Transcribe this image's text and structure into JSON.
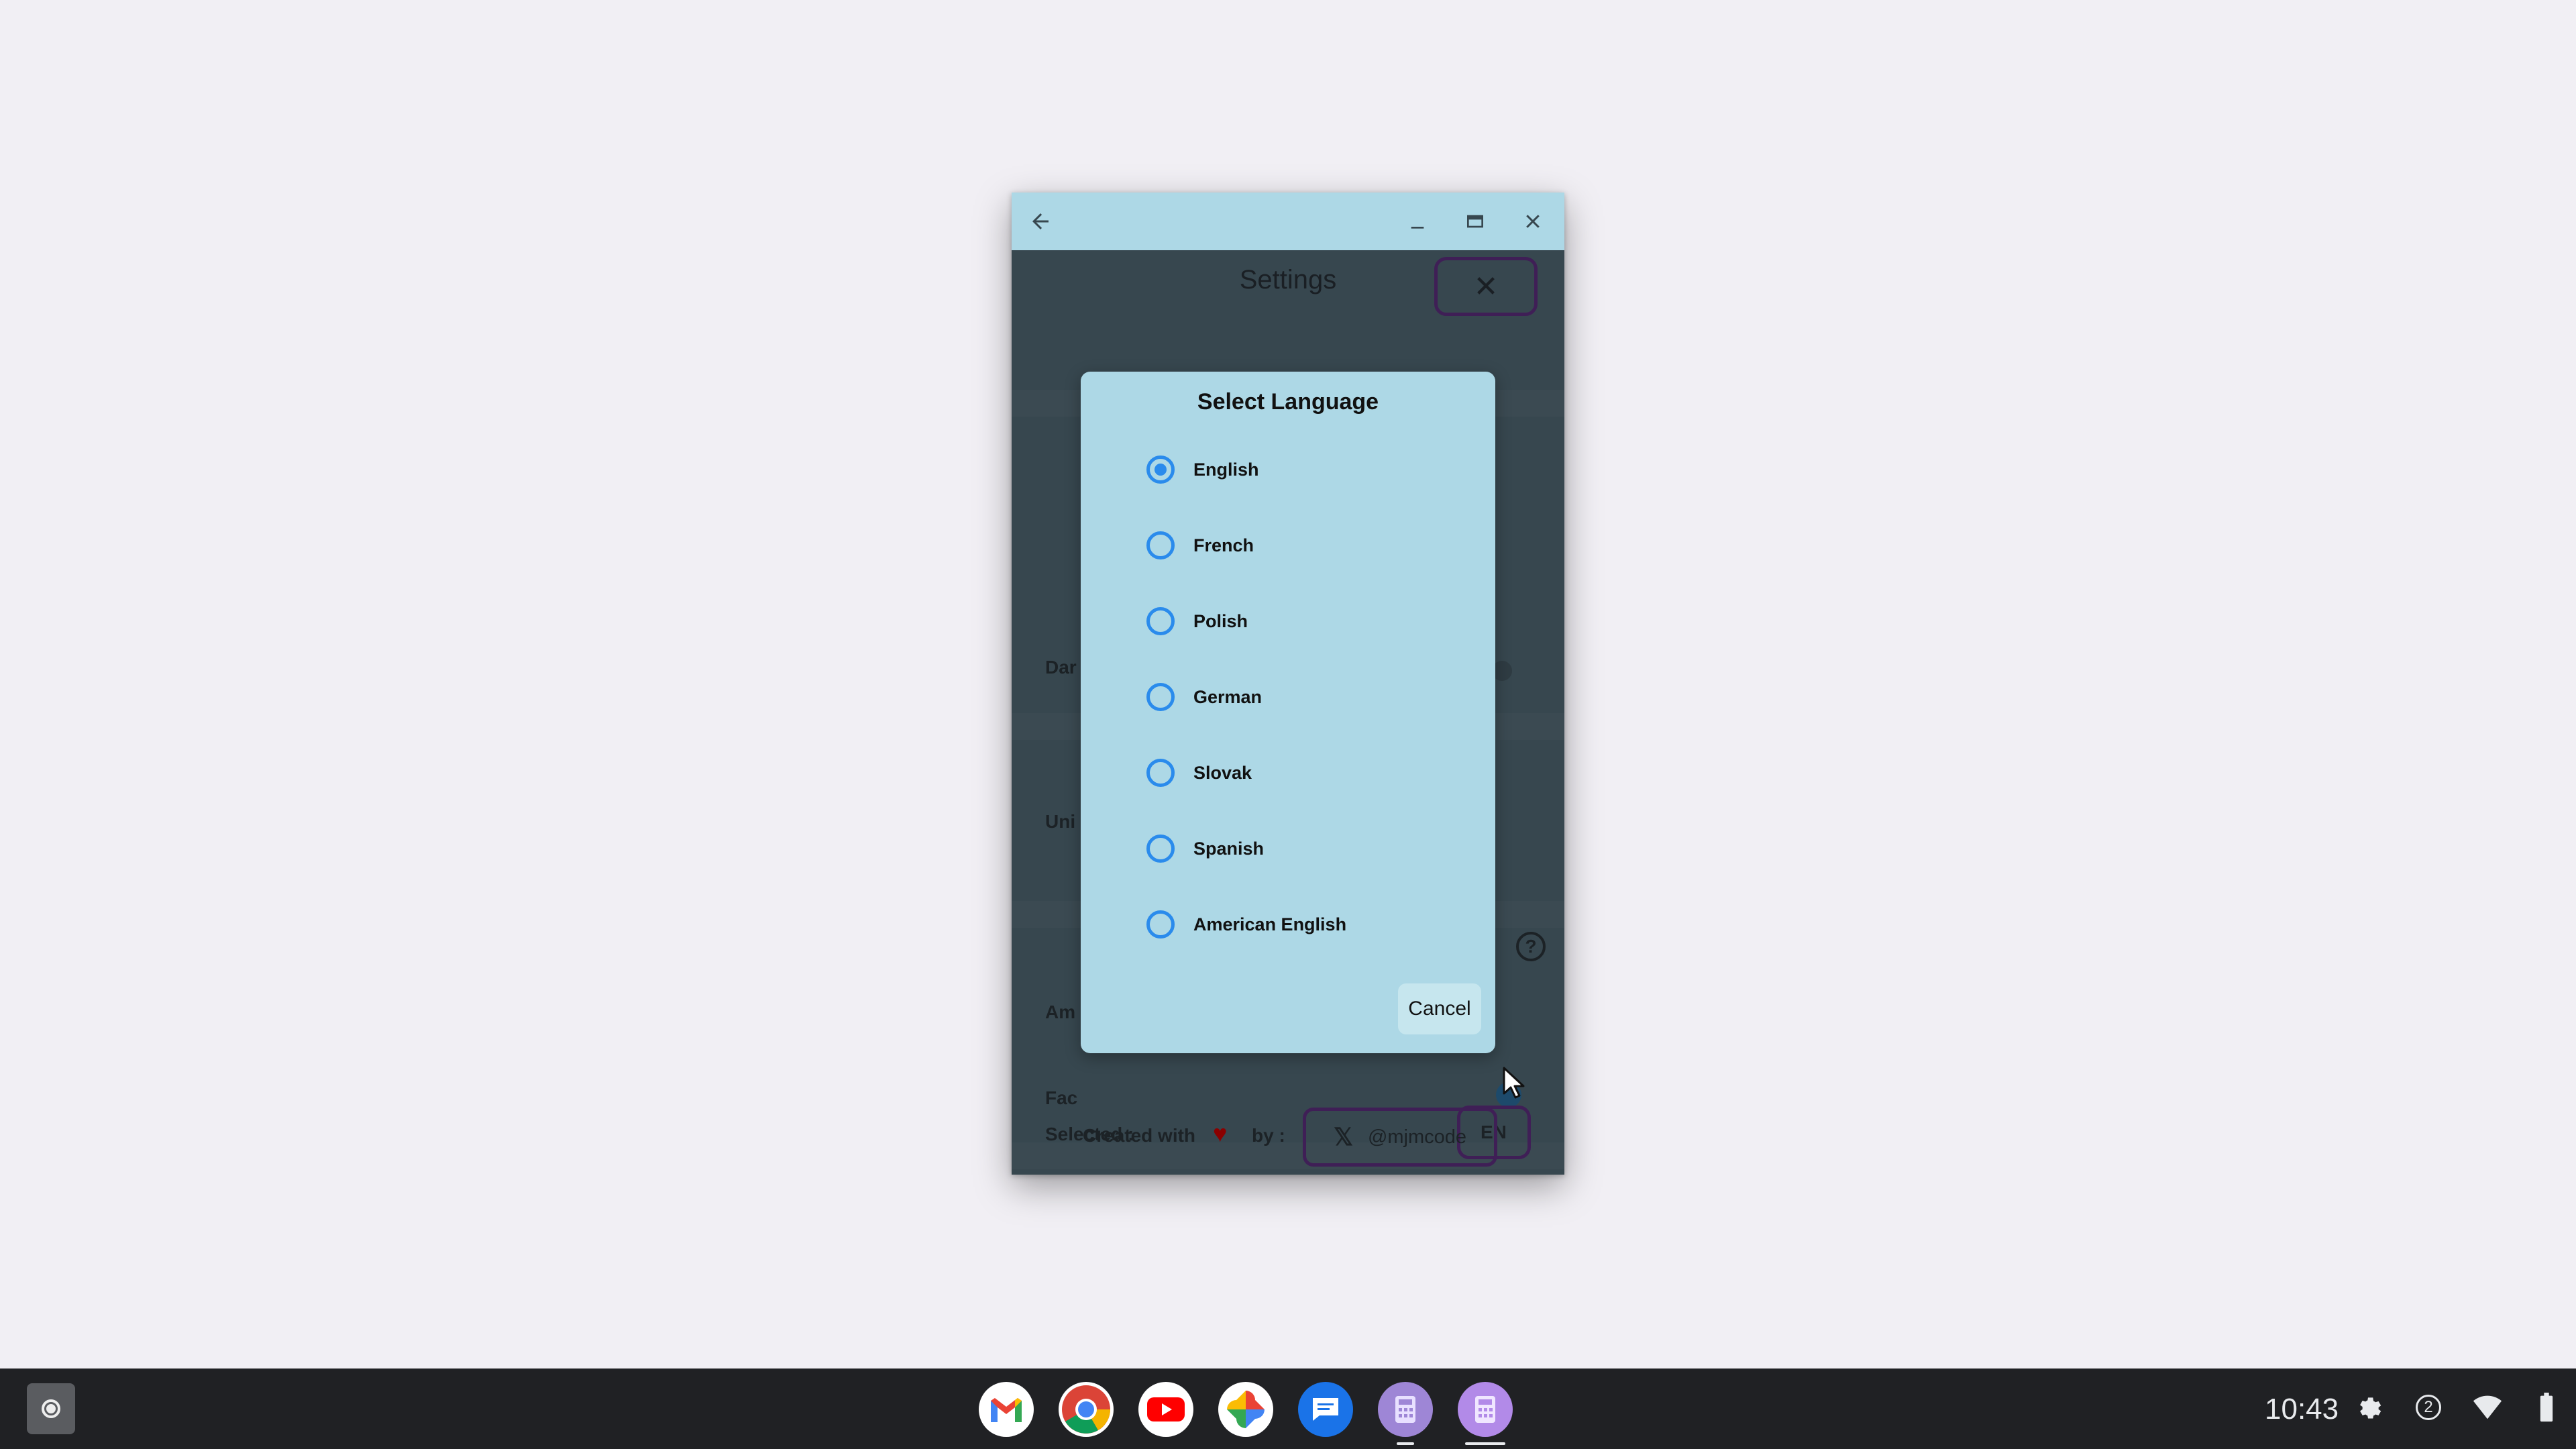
{
  "window": {
    "back_icon": "arrow-left-icon",
    "minimize_icon": "minimize-icon",
    "maximize_icon": "maximize-icon",
    "close_icon": "close-icon"
  },
  "settings": {
    "title": "Settings",
    "close_glyph": "✕",
    "rows": {
      "dark_label": "Dar",
      "units_label": "Uni",
      "amp_label": "Am",
      "fact_label": "Fac"
    },
    "help_glyph": "?",
    "selected_label": "Selected :",
    "selected_value": "EN",
    "footer": {
      "created_with": "Created with",
      "by": "by :",
      "x_logo": "𝕏",
      "handle": "@mjmcode"
    }
  },
  "dialog": {
    "title": "Select Language",
    "options": [
      {
        "label": "English",
        "checked": true
      },
      {
        "label": "French",
        "checked": false
      },
      {
        "label": "Polish",
        "checked": false
      },
      {
        "label": "German",
        "checked": false
      },
      {
        "label": "Slovak",
        "checked": false
      },
      {
        "label": "Spanish",
        "checked": false
      },
      {
        "label": "American English",
        "checked": false
      }
    ],
    "cancel_label": "Cancel"
  },
  "shelf": {
    "apps": [
      "Gmail",
      "Chrome",
      "YouTube",
      "Photos",
      "Messages",
      "Calculator",
      "Calculator"
    ],
    "time": "10:43",
    "notification_count": "2",
    "tray_icons": [
      "settings-icon",
      "notification-icon",
      "wifi-icon",
      "battery-icon"
    ]
  },
  "colors": {
    "titlebar": "#add8e6",
    "app_background": "#37474f",
    "dialog_background": "#add8e6",
    "radio_accent": "#2a8bec",
    "outline_accent": "#3f1f56",
    "heart": "#8b0000"
  }
}
